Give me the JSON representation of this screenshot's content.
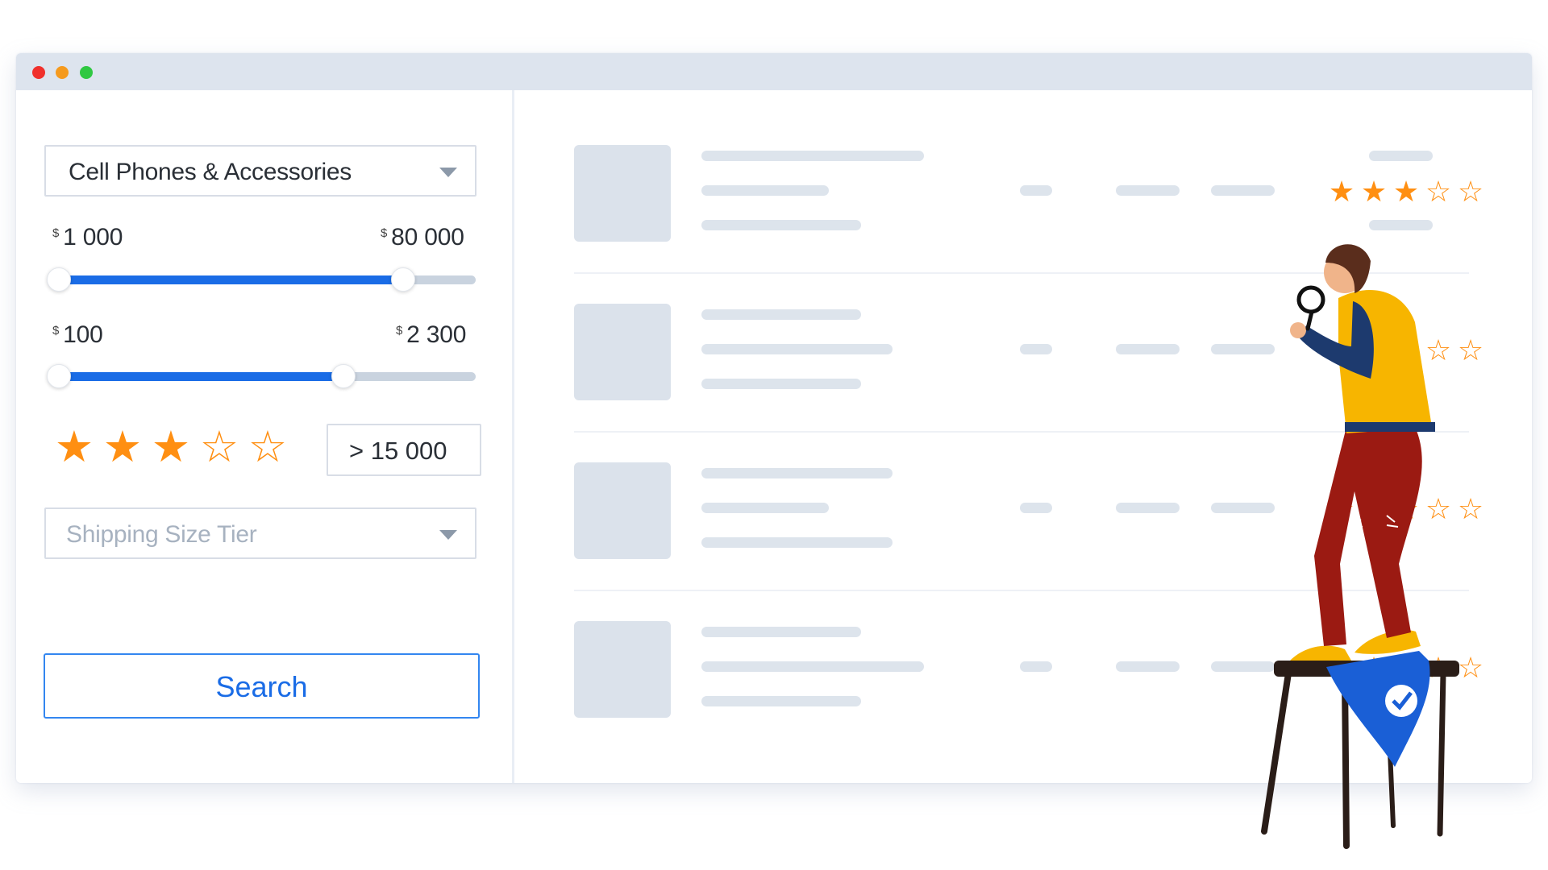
{
  "window": {
    "traffic_lights": [
      "close-dot",
      "minimize-dot",
      "zoom-dot"
    ]
  },
  "filters": {
    "category": {
      "value": "Cell Phones & Accessories"
    },
    "price_range": {
      "currency": "$",
      "min_label": "1 000",
      "max_label": "80 000",
      "low_fraction": 0.02,
      "high_fraction": 0.83
    },
    "second_range": {
      "currency": "$",
      "min_label": "100",
      "max_label": "2 300",
      "low_fraction": 0.02,
      "high_fraction": 0.69
    },
    "rating": {
      "stars": [
        "★",
        "★",
        "★",
        "☆",
        "☆"
      ],
      "value": 3,
      "max": 5
    },
    "count_value": "> 15 000",
    "shipping": {
      "placeholder": "Shipping Size Tier"
    },
    "search_label": "Search"
  },
  "results": {
    "rows": [
      {
        "stars": [
          "★",
          "★",
          "★",
          "☆",
          "☆"
        ]
      },
      {
        "stars": [
          "★",
          "★",
          "★",
          "☆",
          "☆"
        ]
      },
      {
        "stars": [
          "★",
          "★",
          "★",
          "☆",
          "☆"
        ]
      },
      {
        "stars": [
          "★",
          "★",
          "★",
          "☆",
          "☆"
        ]
      }
    ]
  },
  "colors": {
    "accent": "#1a6ce6",
    "star": "#ff8f12",
    "placeholder_bar": "#dde4ec",
    "titlebar": "#dde4ee",
    "jacket": "#f7b500",
    "sleeve": "#1d3a6e",
    "pants": "#9b1a12",
    "stool": "#2a1d18",
    "cloth": "#1a5fd6"
  },
  "illustration": {
    "name": "person-with-magnifier-on-stool"
  }
}
